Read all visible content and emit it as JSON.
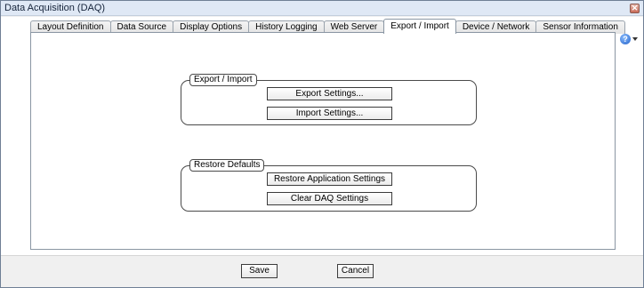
{
  "window": {
    "title": "Data Acquisition (DAQ)",
    "close_glyph": "✕",
    "help_glyph": "?",
    "close_icon": "close-icon",
    "help_icon": "help-icon"
  },
  "tabs": [
    {
      "label": "Layout Definition",
      "active": false
    },
    {
      "label": "Data Source",
      "active": false
    },
    {
      "label": "Display Options",
      "active": false
    },
    {
      "label": "History Logging",
      "active": false
    },
    {
      "label": "Web Server",
      "active": false
    },
    {
      "label": "Export / Import",
      "active": true
    },
    {
      "label": "Device / Network",
      "active": false
    },
    {
      "label": "Sensor Information",
      "active": false
    }
  ],
  "export_import": {
    "title": "Export / Import",
    "export_button": "Export Settings...",
    "import_button": "Import Settings..."
  },
  "restore_defaults": {
    "title": "Restore Defaults",
    "restore_button": "Restore Application Settings",
    "clear_button": "Clear DAQ Settings"
  },
  "footer": {
    "save_label": "Save",
    "cancel_label": "Cancel"
  }
}
